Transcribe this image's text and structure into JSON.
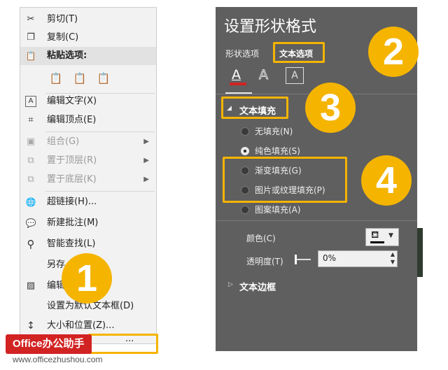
{
  "context_menu": {
    "items": [
      {
        "label": "剪切(T)",
        "icon": "scissors-icon",
        "glyph": "✂",
        "enabled": true
      },
      {
        "label": "复制(C)",
        "icon": "copy-icon",
        "glyph": "❐",
        "enabled": true
      },
      {
        "label": "粘贴选项:",
        "icon": "clipboard-icon",
        "glyph": "📋",
        "enabled": true
      },
      {
        "label": "编辑文字(X)",
        "icon": "edit-text-icon",
        "glyph": "A",
        "enabled": true
      },
      {
        "label": "编辑顶点(E)",
        "icon": "edit-points-icon",
        "glyph": "⌗",
        "enabled": true
      },
      {
        "label": "组合(G)",
        "icon": "group-icon",
        "glyph": "▣",
        "enabled": false,
        "submenu": true
      },
      {
        "label": "置于顶层(R)",
        "icon": "bring-front-icon",
        "glyph": "⧉",
        "enabled": false,
        "submenu": true
      },
      {
        "label": "置于底层(K)",
        "icon": "send-back-icon",
        "glyph": "⧉",
        "enabled": false,
        "submenu": true
      },
      {
        "label": "超链接(H)...",
        "icon": "hyperlink-icon",
        "glyph": "🌐",
        "enabled": true
      },
      {
        "label": "新建批注(M)",
        "icon": "comment-icon",
        "glyph": "💬",
        "enabled": true
      },
      {
        "label": "智能查找(L)",
        "icon": "smart-lookup-icon",
        "glyph": "⚲",
        "enabled": true
      },
      {
        "label": "另存",
        "icon": "",
        "glyph": "",
        "enabled": true
      },
      {
        "label": "编辑",
        "icon": "edit-picture-icon",
        "glyph": "▨",
        "enabled": true
      },
      {
        "label": "设置为默认文本框(D)",
        "icon": "",
        "glyph": "",
        "enabled": true
      },
      {
        "label": "大小和位置(Z)...",
        "icon": "size-position-icon",
        "glyph": "↕",
        "enabled": true
      },
      {
        "label": "...",
        "icon": "",
        "glyph": "",
        "enabled": true
      }
    ],
    "paste_buttons": [
      {
        "icon": "paste-keep-source-icon",
        "glyph": "📋"
      },
      {
        "icon": "paste-picture-icon",
        "glyph": "📋"
      },
      {
        "icon": "paste-text-only-icon",
        "glyph": "📋"
      }
    ]
  },
  "format_panel": {
    "title": "设置形状格式",
    "tabs": [
      "形状选项",
      "文本选项"
    ],
    "icon_tabs": [
      {
        "icon": "text-fill-outline-icon",
        "glyph": "A"
      },
      {
        "icon": "text-effects-icon",
        "glyph": "A"
      },
      {
        "icon": "textbox-icon",
        "glyph": "A"
      }
    ],
    "section_fill": "文本填充",
    "fill_options": [
      {
        "label": "无填充(N)",
        "selected": false
      },
      {
        "label": "纯色填充(S)",
        "selected": true
      },
      {
        "label": "渐变填充(G)",
        "selected": false
      },
      {
        "label": "图片或纹理填充(P)",
        "selected": false
      },
      {
        "label": "图案填充(A)",
        "selected": false
      }
    ],
    "color_label": "颜色(C)",
    "transparency_label": "透明度(T)",
    "transparency_value": "0%",
    "section_outline": "文本边框"
  },
  "badges": [
    "1",
    "2",
    "3",
    "4"
  ],
  "watermark": {
    "brand": "Office办公助手",
    "site": "www.officezhushou.com"
  },
  "colors": {
    "highlight": "#f5b400",
    "panel_bg": "#5f5f5f",
    "brand_red": "#d22323",
    "fill_color": "#000000"
  }
}
